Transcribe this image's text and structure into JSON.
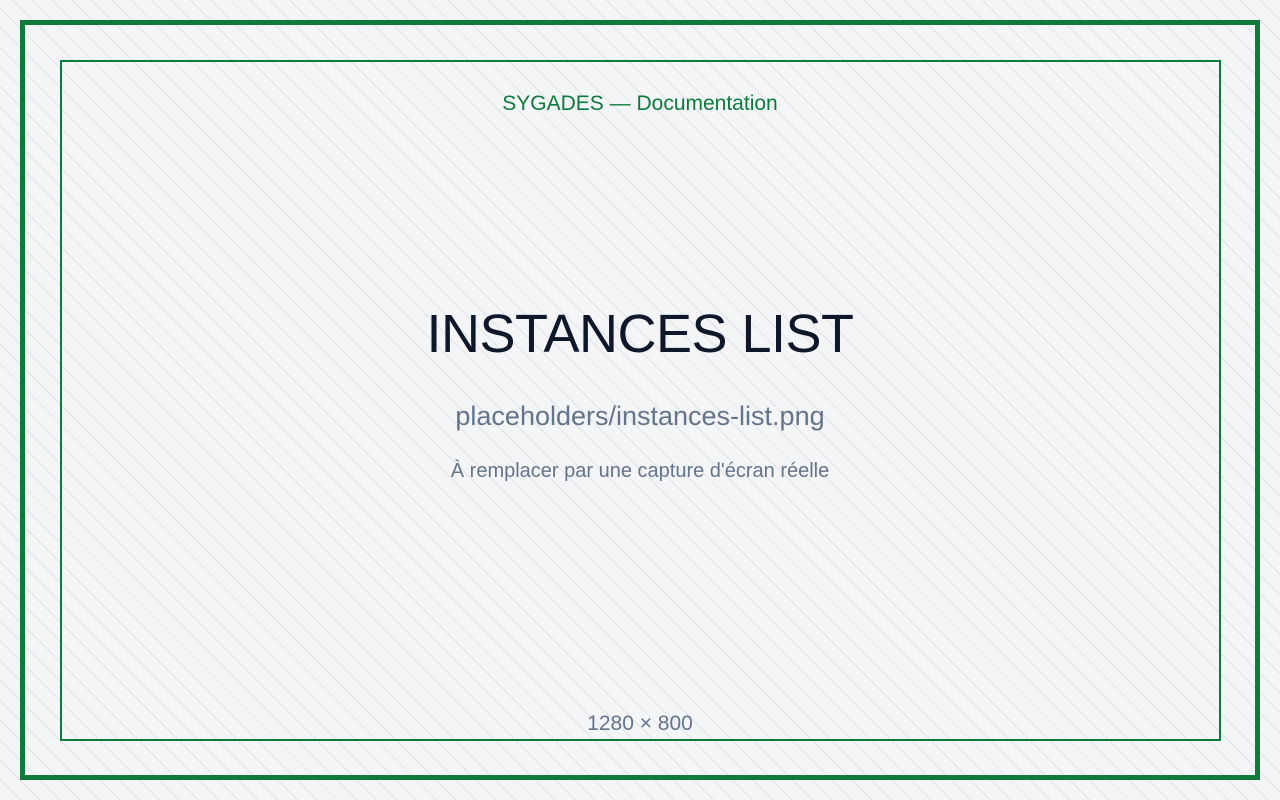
{
  "header": {
    "title": "SYGADES — Documentation"
  },
  "placeholder": {
    "title": "INSTANCES LIST",
    "path": "placeholders/instances-list.png",
    "note": "À remplacer par une capture d'écran réelle",
    "dimensions": "1280 × 800"
  },
  "colors": {
    "accent": "#0f7a3c",
    "background": "#f3f5f7",
    "title": "#0f172a",
    "muted": "#64748b"
  }
}
